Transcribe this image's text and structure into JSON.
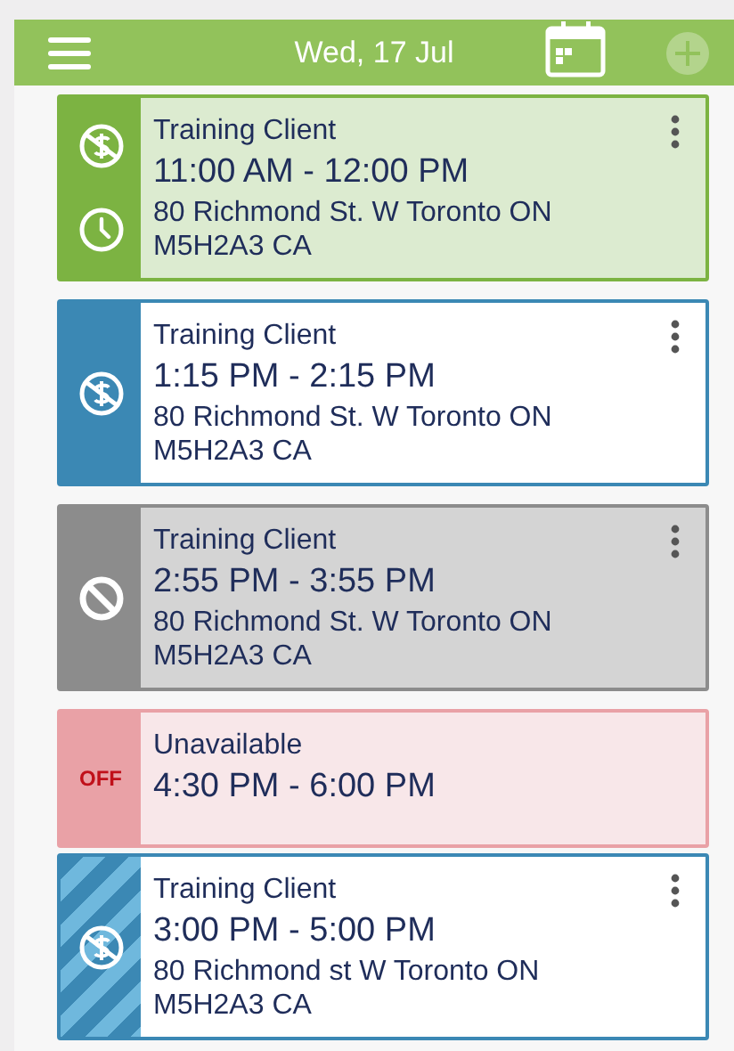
{
  "header": {
    "title": "Wed, 17 Jul",
    "add_disabled": true
  },
  "appointments": [
    {
      "kind": "completed",
      "color": "#7cb342",
      "striped": false,
      "icons": [
        {
          "kind": "no-charge"
        },
        {
          "kind": "clock"
        }
      ],
      "title": "Training Client",
      "time": "11:00 AM - 12:00 PM",
      "address": [
        "80 Richmond St. W Toronto ON",
        "M5H2A3 CA"
      ]
    },
    {
      "kind": "scheduled",
      "color": "#3b88b4",
      "striped": false,
      "icons": [
        {
          "kind": "no-charge"
        }
      ],
      "title": "Training Client",
      "time": "1:15 PM - 2:15 PM",
      "address": [
        "80 Richmond St. W Toronto ON",
        "M5H2A3 CA"
      ]
    },
    {
      "kind": "cancelled",
      "color": "#8c8c8c",
      "striped": false,
      "icons": [
        {
          "kind": "prohibited"
        }
      ],
      "title": "Training Client",
      "time": "2:55 PM - 3:55 PM",
      "address": [
        "80 Richmond St. W Toronto ON",
        "M5H2A3 CA"
      ]
    },
    {
      "kind": "unavailable",
      "color": "#e9a1a6",
      "striped": false,
      "badge": "OFF",
      "title": "Unavailable",
      "time": "4:30 PM - 6:00 PM"
    },
    {
      "kind": "scheduled",
      "color": "#3b88b4",
      "striped": true,
      "icons": [
        {
          "kind": "no-charge"
        }
      ],
      "title": "Training Client",
      "time": "3:00 PM - 5:00 PM",
      "address": [
        "80 Richmond st W Toronto ON",
        "M5H2A3 CA"
      ]
    }
  ]
}
